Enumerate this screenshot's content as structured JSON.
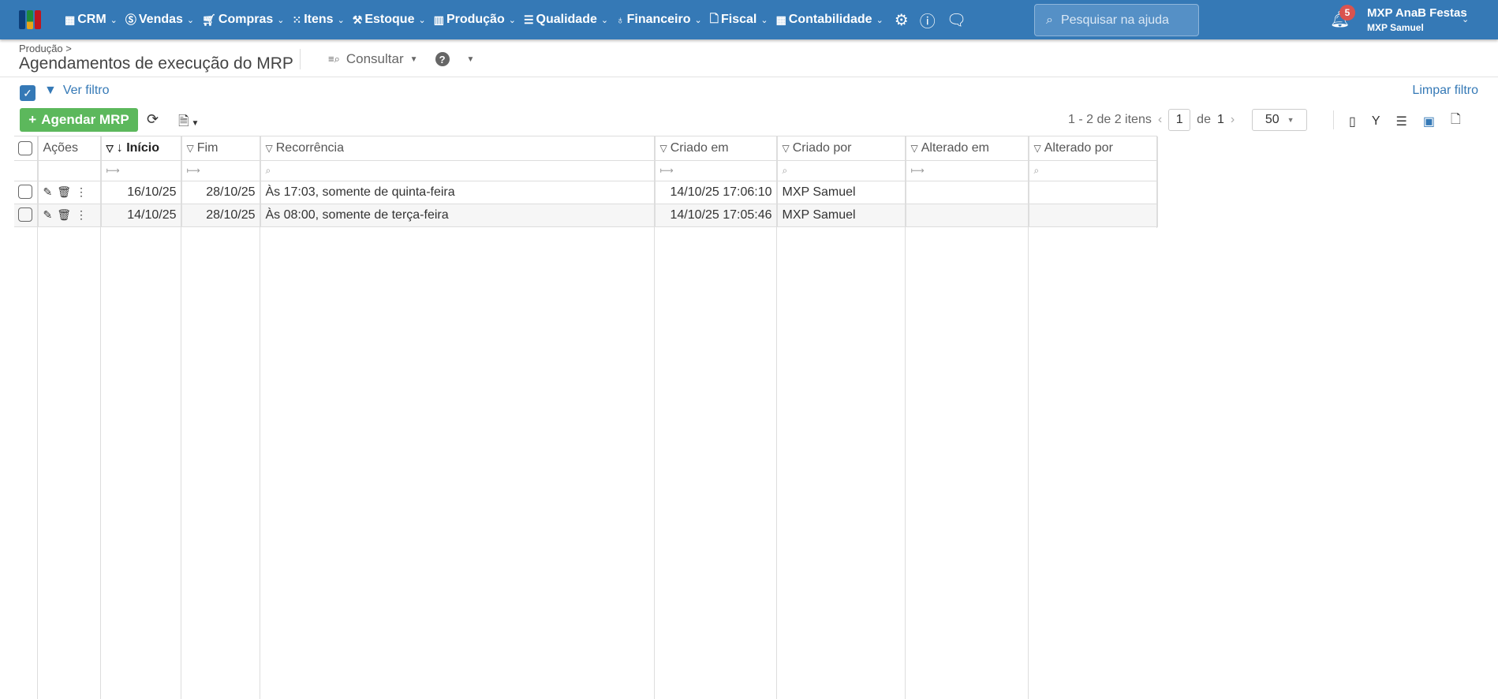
{
  "nav": {
    "menus": [
      {
        "label": "CRM",
        "icon": "crm-icon"
      },
      {
        "label": "Vendas",
        "icon": "dollar-icon"
      },
      {
        "label": "Compras",
        "icon": "cart-icon"
      },
      {
        "label": "Itens",
        "icon": "items-icon"
      },
      {
        "label": "Estoque",
        "icon": "stock-icon"
      },
      {
        "label": "Produção",
        "icon": "factory-icon"
      },
      {
        "label": "Qualidade",
        "icon": "checklist-icon"
      },
      {
        "label": "Financeiro",
        "icon": "money-bag-icon"
      },
      {
        "label": "Fiscal",
        "icon": "document-icon"
      },
      {
        "label": "Contabilidade",
        "icon": "calculator-icon"
      }
    ],
    "search_placeholder": "Pesquisar na ajuda",
    "notifications": "5",
    "company": "MXP AnaB Festas",
    "user": "MXP Samuel"
  },
  "page": {
    "breadcrumb": "Produção >",
    "title": "Agendamentos de execução do MRP",
    "consult": "Consultar"
  },
  "toolbar": {
    "ver_filtro": "Ver filtro",
    "limpar_filtro": "Limpar filtro",
    "add": "Agendar MRP",
    "range": "1 - 2 de 2 itens",
    "page": "1",
    "de": "de",
    "total_pages": "1",
    "page_size": "50"
  },
  "table": {
    "headers": [
      "Ações",
      "Início",
      "Fim",
      "Recorrência",
      "Criado em",
      "Criado por",
      "Alterado em",
      "Alterado por"
    ],
    "rows": [
      {
        "inicio": "16/10/25",
        "fim": "28/10/25",
        "recorrencia": "Às 17:03, somente de quinta-feira",
        "criado_em": "14/10/25 17:06:10",
        "criado_por": "MXP Samuel",
        "alterado_em": "",
        "alterado_por": ""
      },
      {
        "inicio": "14/10/25",
        "fim": "28/10/25",
        "recorrencia": "Às 08:00, somente de terça-feira",
        "criado_em": "14/10/25 17:05:46",
        "criado_por": "MXP Samuel",
        "alterado_em": "",
        "alterado_por": ""
      }
    ]
  },
  "colors": {
    "primary": "#3579b6",
    "success": "#5cb85c",
    "badge": "#d9534f"
  }
}
